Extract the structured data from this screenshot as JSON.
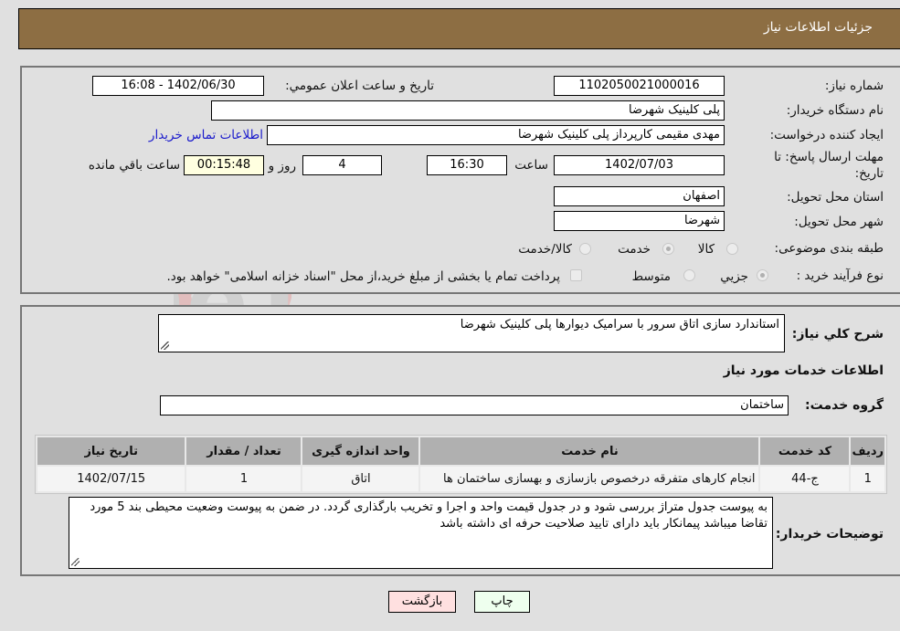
{
  "header": {
    "title": "جزئیات اطلاعات نیاز"
  },
  "form": {
    "need_number": {
      "label": "شماره نیاز:",
      "value": "1102050021000016"
    },
    "announce_datetime": {
      "label": "تاریخ و ساعت اعلان عمومي:",
      "value": "1402/06/30 - 16:08"
    },
    "buyer_org": {
      "label": "نام دستگاه خریدار:",
      "value": "پلی کلینیک شهرضا"
    },
    "requester": {
      "label": "ایجاد کننده درخواست:",
      "value": "مهدی مقیمی کارپرداز پلی کلینیک شهرضا"
    },
    "buyer_contact_link": "اطلاعات تماس خریدار",
    "deadline": {
      "label_line1": "مهلت ارسال پاسخ: تا",
      "label_line2": "تاریخ:",
      "date": "1402/07/03",
      "time_label": "ساعت",
      "time": "16:30",
      "days": "4",
      "days_label": "روز و",
      "remaining": "00:15:48",
      "remaining_label": "ساعت باقي مانده"
    },
    "province": {
      "label": "استان محل تحویل:",
      "value": "اصفهان"
    },
    "city": {
      "label": "شهر محل تحویل:",
      "value": "شهرضا"
    },
    "category": {
      "label": "طبقه بندی موضوعی:",
      "options": [
        {
          "label": "کالا",
          "selected": false
        },
        {
          "label": "خدمت",
          "selected": true
        },
        {
          "label": "کالا/خدمت",
          "selected": false
        }
      ]
    },
    "purchase_type": {
      "label": "نوع فرآیند خرید :",
      "options": [
        {
          "label": "جزيي",
          "selected": true
        },
        {
          "label": "متوسط",
          "selected": false
        }
      ],
      "treasury_checkbox_label": "پرداخت تمام یا بخشی از مبلغ خرید،از محل \"اسناد خزانه اسلامی\" خواهد بود.",
      "treasury_checked": false
    }
  },
  "details": {
    "general_desc_label": "شرح کلي نیاز:",
    "general_desc": "استاندارد سازی اتاق سرور با سرامیک دیوارها پلی کلینیک شهرضا",
    "services_heading": "اطلاعات خدمات مورد نیاز",
    "service_group_label": "گروه خدمت:",
    "service_group": "ساختمان",
    "table": {
      "headers": [
        "ردیف",
        "کد خدمت",
        "نام خدمت",
        "واحد اندازه گیری",
        "تعداد / مقدار",
        "تاریخ نیاز"
      ],
      "rows": [
        [
          "1",
          "ج-44",
          "انجام کارهای متفرقه درخصوص بازسازی و بهسازی ساختمان ها",
          "اتاق",
          "1",
          "1402/07/15"
        ]
      ]
    },
    "buyer_notes_label": "توضیحات خریدار:",
    "buyer_notes": "به پیوست جدول متراژ بررسی شود و در جدول قیمت واحد و اجرا و تخریب بارگذاری گردد. در ضمن به پیوست وضعیت محیطی بند 5 مورد تقاضا میباشد پیمانکار باید دارای تایید صلاحیت حرفه ای  داشته باشد"
  },
  "buttons": {
    "print": "چاپ",
    "back": "بازگشت"
  },
  "watermark": "AriaTender.neT",
  "colors": {
    "header_bg": "#8d6e43",
    "print_bg": "#eeffee",
    "back_bg": "#ffe0e0",
    "link": "#1a1acc"
  }
}
